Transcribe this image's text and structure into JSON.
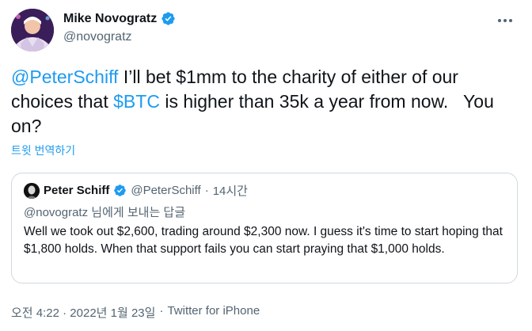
{
  "author": {
    "display_name": "Mike Novogratz",
    "handle": "@novogratz"
  },
  "tweet": {
    "mention": "@PeterSchiff",
    "text_part1": " I’ll bet $1mm to the charity of either of our choices that ",
    "cashtag": "$BTC",
    "text_part2": " is higher than 35k a year from now.   You on?",
    "translate_label": "트윗 번역하기"
  },
  "quoted_tweet": {
    "display_name": "Peter Schiff",
    "handle": "@PeterSchiff",
    "separator": "·",
    "time": "14시간",
    "reply_mention": "@novogratz",
    "reply_suffix": " 님에게 보내는 답글",
    "text": "Well we took out $2,600, trading around $2,300 now. I guess it's time to start hoping that $1,800 holds. When that support fails you can start praying that $1,000 holds."
  },
  "meta": {
    "timestamp": "오전 4:22 · 2022년 1월 23일",
    "separator": "·",
    "source": "Twitter for iPhone"
  },
  "colors": {
    "link": "#1d9bf0",
    "secondary_text": "#536471",
    "border": "#cfd9de",
    "verified": "#1d9bf0"
  },
  "icons": {
    "verified": "verified-badge-icon",
    "more": "more-options-icon"
  }
}
